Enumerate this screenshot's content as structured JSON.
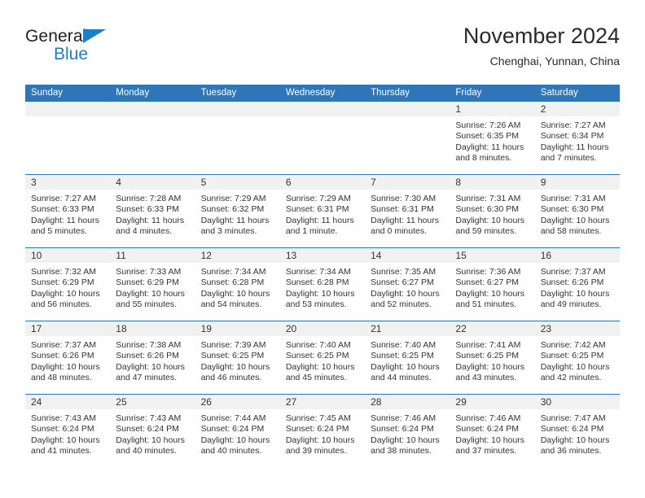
{
  "brand": {
    "name_top": "General",
    "name_bottom": "Blue",
    "triangle_color": "#1c7fc4"
  },
  "header": {
    "title": "November 2024",
    "location": "Chenghai, Yunnan, China"
  },
  "theme": {
    "header_blue": "#2f76b8",
    "daynum_band": "#f1f1f1",
    "text": "#333333"
  },
  "weekdays": [
    "Sunday",
    "Monday",
    "Tuesday",
    "Wednesday",
    "Thursday",
    "Friday",
    "Saturday"
  ],
  "labels": {
    "sunrise_prefix": "Sunrise:",
    "sunset_prefix": "Sunset:",
    "daylight_prefix": "Daylight:"
  },
  "weeks": [
    [
      {
        "day": "",
        "empty": true
      },
      {
        "day": "",
        "empty": true
      },
      {
        "day": "",
        "empty": true
      },
      {
        "day": "",
        "empty": true
      },
      {
        "day": "",
        "empty": true
      },
      {
        "day": "1",
        "sunrise": "Sunrise: 7:26 AM",
        "sunset": "Sunset: 6:35 PM",
        "daylight": "Daylight: 11 hours and 8 minutes."
      },
      {
        "day": "2",
        "sunrise": "Sunrise: 7:27 AM",
        "sunset": "Sunset: 6:34 PM",
        "daylight": "Daylight: 11 hours and 7 minutes."
      }
    ],
    [
      {
        "day": "3",
        "sunrise": "Sunrise: 7:27 AM",
        "sunset": "Sunset: 6:33 PM",
        "daylight": "Daylight: 11 hours and 5 minutes."
      },
      {
        "day": "4",
        "sunrise": "Sunrise: 7:28 AM",
        "sunset": "Sunset: 6:33 PM",
        "daylight": "Daylight: 11 hours and 4 minutes."
      },
      {
        "day": "5",
        "sunrise": "Sunrise: 7:29 AM",
        "sunset": "Sunset: 6:32 PM",
        "daylight": "Daylight: 11 hours and 3 minutes."
      },
      {
        "day": "6",
        "sunrise": "Sunrise: 7:29 AM",
        "sunset": "Sunset: 6:31 PM",
        "daylight": "Daylight: 11 hours and 1 minute."
      },
      {
        "day": "7",
        "sunrise": "Sunrise: 7:30 AM",
        "sunset": "Sunset: 6:31 PM",
        "daylight": "Daylight: 11 hours and 0 minutes."
      },
      {
        "day": "8",
        "sunrise": "Sunrise: 7:31 AM",
        "sunset": "Sunset: 6:30 PM",
        "daylight": "Daylight: 10 hours and 59 minutes."
      },
      {
        "day": "9",
        "sunrise": "Sunrise: 7:31 AM",
        "sunset": "Sunset: 6:30 PM",
        "daylight": "Daylight: 10 hours and 58 minutes."
      }
    ],
    [
      {
        "day": "10",
        "sunrise": "Sunrise: 7:32 AM",
        "sunset": "Sunset: 6:29 PM",
        "daylight": "Daylight: 10 hours and 56 minutes."
      },
      {
        "day": "11",
        "sunrise": "Sunrise: 7:33 AM",
        "sunset": "Sunset: 6:29 PM",
        "daylight": "Daylight: 10 hours and 55 minutes."
      },
      {
        "day": "12",
        "sunrise": "Sunrise: 7:34 AM",
        "sunset": "Sunset: 6:28 PM",
        "daylight": "Daylight: 10 hours and 54 minutes."
      },
      {
        "day": "13",
        "sunrise": "Sunrise: 7:34 AM",
        "sunset": "Sunset: 6:28 PM",
        "daylight": "Daylight: 10 hours and 53 minutes."
      },
      {
        "day": "14",
        "sunrise": "Sunrise: 7:35 AM",
        "sunset": "Sunset: 6:27 PM",
        "daylight": "Daylight: 10 hours and 52 minutes."
      },
      {
        "day": "15",
        "sunrise": "Sunrise: 7:36 AM",
        "sunset": "Sunset: 6:27 PM",
        "daylight": "Daylight: 10 hours and 51 minutes."
      },
      {
        "day": "16",
        "sunrise": "Sunrise: 7:37 AM",
        "sunset": "Sunset: 6:26 PM",
        "daylight": "Daylight: 10 hours and 49 minutes."
      }
    ],
    [
      {
        "day": "17",
        "sunrise": "Sunrise: 7:37 AM",
        "sunset": "Sunset: 6:26 PM",
        "daylight": "Daylight: 10 hours and 48 minutes."
      },
      {
        "day": "18",
        "sunrise": "Sunrise: 7:38 AM",
        "sunset": "Sunset: 6:26 PM",
        "daylight": "Daylight: 10 hours and 47 minutes."
      },
      {
        "day": "19",
        "sunrise": "Sunrise: 7:39 AM",
        "sunset": "Sunset: 6:25 PM",
        "daylight": "Daylight: 10 hours and 46 minutes."
      },
      {
        "day": "20",
        "sunrise": "Sunrise: 7:40 AM",
        "sunset": "Sunset: 6:25 PM",
        "daylight": "Daylight: 10 hours and 45 minutes."
      },
      {
        "day": "21",
        "sunrise": "Sunrise: 7:40 AM",
        "sunset": "Sunset: 6:25 PM",
        "daylight": "Daylight: 10 hours and 44 minutes."
      },
      {
        "day": "22",
        "sunrise": "Sunrise: 7:41 AM",
        "sunset": "Sunset: 6:25 PM",
        "daylight": "Daylight: 10 hours and 43 minutes."
      },
      {
        "day": "23",
        "sunrise": "Sunrise: 7:42 AM",
        "sunset": "Sunset: 6:25 PM",
        "daylight": "Daylight: 10 hours and 42 minutes."
      }
    ],
    [
      {
        "day": "24",
        "sunrise": "Sunrise: 7:43 AM",
        "sunset": "Sunset: 6:24 PM",
        "daylight": "Daylight: 10 hours and 41 minutes."
      },
      {
        "day": "25",
        "sunrise": "Sunrise: 7:43 AM",
        "sunset": "Sunset: 6:24 PM",
        "daylight": "Daylight: 10 hours and 40 minutes."
      },
      {
        "day": "26",
        "sunrise": "Sunrise: 7:44 AM",
        "sunset": "Sunset: 6:24 PM",
        "daylight": "Daylight: 10 hours and 40 minutes."
      },
      {
        "day": "27",
        "sunrise": "Sunrise: 7:45 AM",
        "sunset": "Sunset: 6:24 PM",
        "daylight": "Daylight: 10 hours and 39 minutes."
      },
      {
        "day": "28",
        "sunrise": "Sunrise: 7:46 AM",
        "sunset": "Sunset: 6:24 PM",
        "daylight": "Daylight: 10 hours and 38 minutes."
      },
      {
        "day": "29",
        "sunrise": "Sunrise: 7:46 AM",
        "sunset": "Sunset: 6:24 PM",
        "daylight": "Daylight: 10 hours and 37 minutes."
      },
      {
        "day": "30",
        "sunrise": "Sunrise: 7:47 AM",
        "sunset": "Sunset: 6:24 PM",
        "daylight": "Daylight: 10 hours and 36 minutes."
      }
    ]
  ]
}
